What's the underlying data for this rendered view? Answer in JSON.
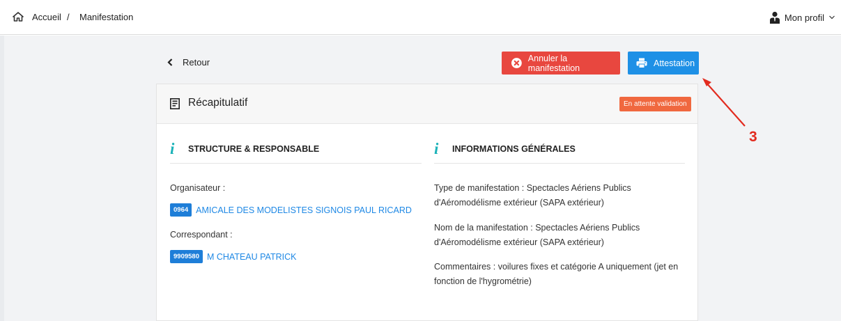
{
  "breadcrumb": {
    "home_label": "Accueil",
    "separator": "/",
    "current_label": "Manifestation"
  },
  "profile": {
    "label": "Mon profil"
  },
  "toolbar": {
    "back_label": "Retour",
    "cancel_label": "Annuler la manifestation",
    "attestation_label": "Attestation"
  },
  "summary": {
    "title": "Récapitulatif",
    "status": "En attente validation",
    "structure": {
      "heading": "STRUCTURE & RESPONSABLE",
      "organizer_label": "Organisateur :",
      "organizer_id": "0964",
      "organizer_name": "AMICALE DES MODELISTES SIGNOIS PAUL RICARD",
      "correspondent_label": "Correspondant :",
      "correspondent_id": "9909580",
      "correspondent_name": "M CHATEAU PATRICK"
    },
    "general": {
      "heading": "INFORMATIONS GÉNÉRALES",
      "type_line1": "Type de manifestation : Spectacles Aériens Publics",
      "type_line2": "d'Aéromodélisme extérieur (SAPA extérieur)",
      "name_line1": "Nom de la manifestation : Spectacles Aériens Publics",
      "name_line2": "d'Aéromodélisme extérieur (SAPA extérieur)",
      "comment_line1": "Commentaires : voilures fixes et catégorie A uniquement (jet en",
      "comment_line2": "fonction de l'hygrométrie)"
    }
  },
  "annotation": {
    "number": "3",
    "color": "#e22b1f"
  },
  "colors": {
    "danger": "#e8473f",
    "primary": "#1e90e6",
    "status_badge": "#f0683f",
    "info_icon": "#1bb2b8",
    "link": "#1e88e5"
  },
  "icons": {
    "home": "home-icon",
    "user": "user-icon",
    "dropdown": "chevron-down-icon",
    "back": "chevron-left-icon",
    "cancel": "close-circle-icon",
    "print": "printer-icon",
    "document": "document-icon",
    "info": "info-icon"
  }
}
